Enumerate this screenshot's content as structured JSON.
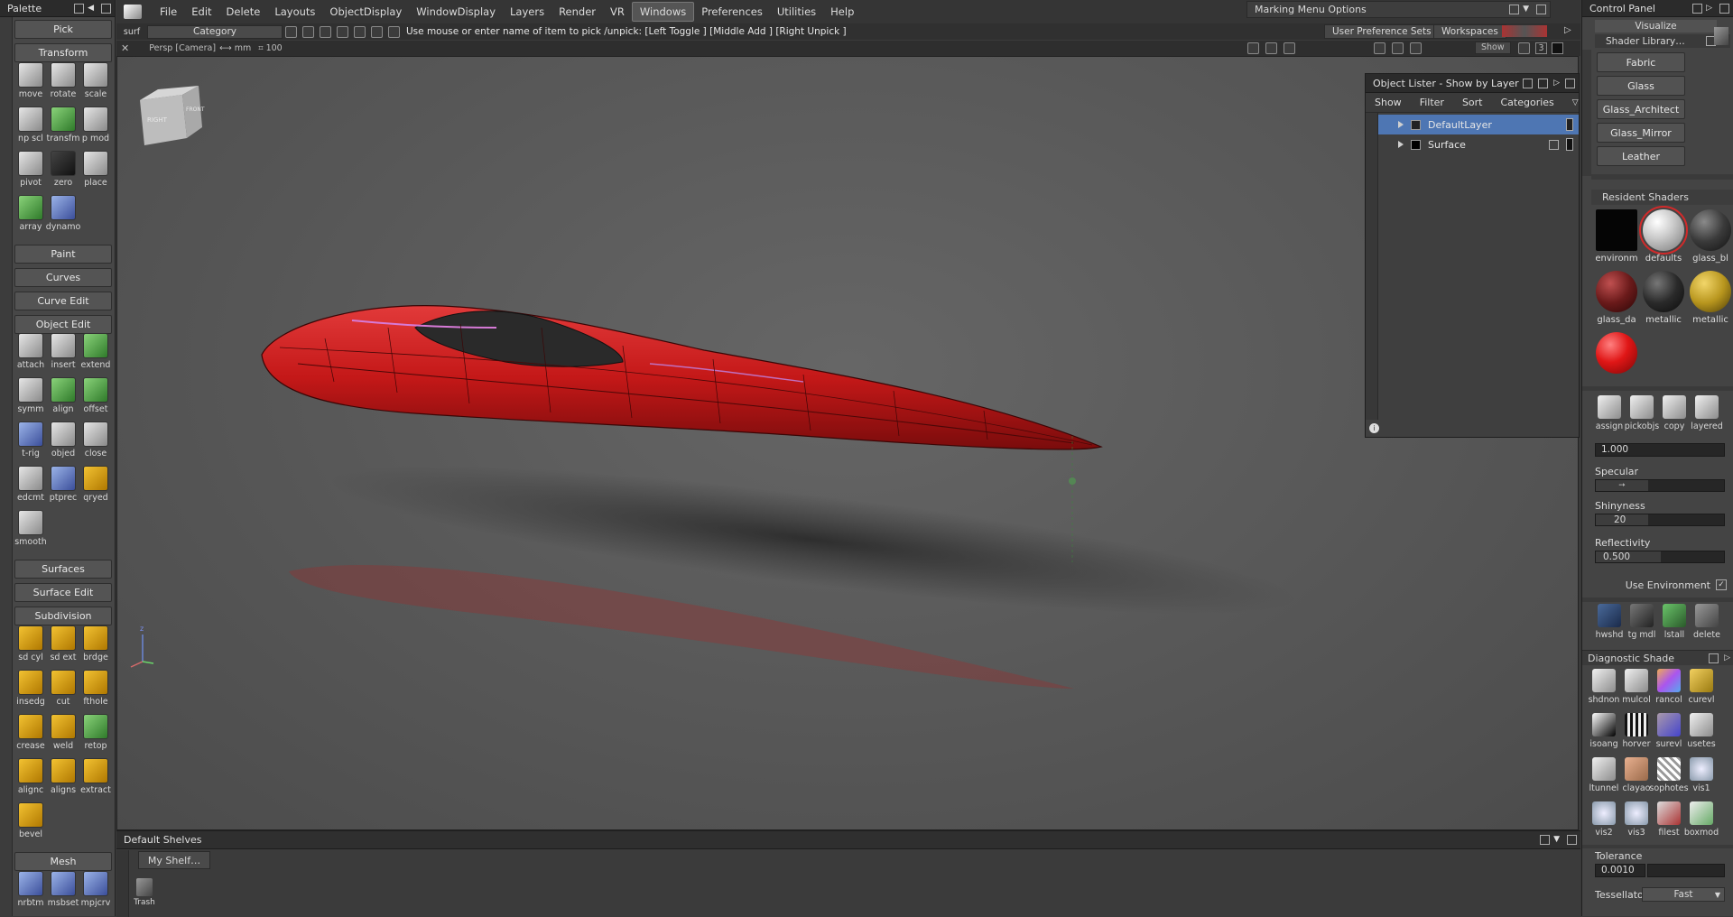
{
  "palette": {
    "title": "Palette",
    "pick": "Pick",
    "transform": "Transform",
    "transform_tools": [
      "move",
      "rotate",
      "scale",
      "np scl",
      "transfm",
      "p mod",
      "pivot",
      "zero",
      "place",
      "array",
      "dynamo"
    ],
    "paint": "Paint",
    "curves": "Curves",
    "curve_edit": "Curve Edit",
    "object_edit": "Object Edit",
    "object_edit_tools": [
      "attach",
      "insert",
      "extend",
      "symm",
      "align",
      "offset",
      "t-rig",
      "objed",
      "close",
      "edcmt",
      "ptprec",
      "qryed",
      "smooth"
    ],
    "surfaces": "Surfaces",
    "surface_edit": "Surface Edit",
    "subdivision": "Subdivision",
    "subdivision_tools": [
      "sd cyl",
      "sd ext",
      "brdge",
      "insedg",
      "cut",
      "fthole",
      "crease",
      "weld",
      "retop",
      "alignc",
      "aligns",
      "extract",
      "bevel"
    ],
    "mesh": "Mesh",
    "mesh_tools": [
      "nrbtm",
      "msbset",
      "mpjcrv"
    ]
  },
  "menubar": {
    "app_icon_label": "surf",
    "items": [
      "File",
      "Edit",
      "Delete",
      "Layouts",
      "ObjectDisplay",
      "WindowDisplay",
      "Layers",
      "Render",
      "VR",
      "Windows",
      "Preferences",
      "Utilities",
      "Help"
    ],
    "active": "Windows",
    "marking_menu": "Marking Menu Options"
  },
  "toolbar": {
    "category": "Category",
    "prompt": "Use mouse or enter name of item to pick /unpick: [Left Toggle ] [Middle Add ] [Right Unpick ]",
    "user_pref_sets": "User Preference Sets",
    "workspaces": "Workspaces"
  },
  "viewport": {
    "camera_label": "Persp [Camera]",
    "units": "mm",
    "grid_value": "100",
    "show_button": "Show",
    "num_button": "3",
    "viewcube_right": "RIGHT",
    "viewcube_front": "FRONT",
    "axis_z": "z"
  },
  "lister": {
    "title": "Object Lister - Show by Layer",
    "tabs": [
      "Show",
      "Filter",
      "Sort",
      "Categories"
    ],
    "layers": [
      {
        "name": "DefaultLayer",
        "selected": true
      },
      {
        "name": "Surface",
        "selected": false
      }
    ]
  },
  "shelves": {
    "title": "Default Shelves",
    "tab": "My Shelf…",
    "trash": "Trash"
  },
  "control_panel": {
    "title": "Control Panel",
    "mode": "Visualize",
    "shader_library": "Shader Library…",
    "library_items": [
      "Fabric",
      "Glass",
      "Glass_Architect",
      "Glass_Mirror",
      "Leather"
    ],
    "resident_shaders": "Resident Shaders",
    "shaders": [
      {
        "name": "environm",
        "color": "#050505"
      },
      {
        "name": "defaults",
        "color": "#f0f0f0"
      },
      {
        "name": "glass_bl",
        "color": "#3a3a3a"
      },
      {
        "name": "glass_da",
        "color": "#6a1a1a"
      },
      {
        "name": "metallic",
        "color": "#2a2a2a"
      },
      {
        "name": "metallic",
        "color": "#b8961e"
      },
      {
        "name": "",
        "color": "#e01616"
      }
    ],
    "shader_tools": [
      "assign",
      "pickobjs",
      "copy",
      "layered"
    ],
    "value_field": "1.000",
    "specular": "Specular",
    "shinyness": "Shinyness",
    "shinyness_value": "20",
    "reflectivity": "Reflectivity",
    "reflectivity_value": "0.500",
    "use_environment": "Use Environment",
    "misc_tools": [
      "hwshd",
      "tg mdl",
      "lstall",
      "delete"
    ],
    "diagnostic_shade": "Diagnostic Shade",
    "diag_tools": [
      "shdnon",
      "mulcol",
      "rancol",
      "curevl",
      "isoang",
      "horver",
      "surevl",
      "usetes",
      "ltunnel",
      "clayao",
      "sophotes",
      "vis1",
      "vis2",
      "vis3",
      "filest",
      "boxmod"
    ],
    "tolerance": "Tolerance",
    "tolerance_value": "0.0010",
    "tessellator": "Tessellator",
    "tessellator_value": "Fast"
  }
}
